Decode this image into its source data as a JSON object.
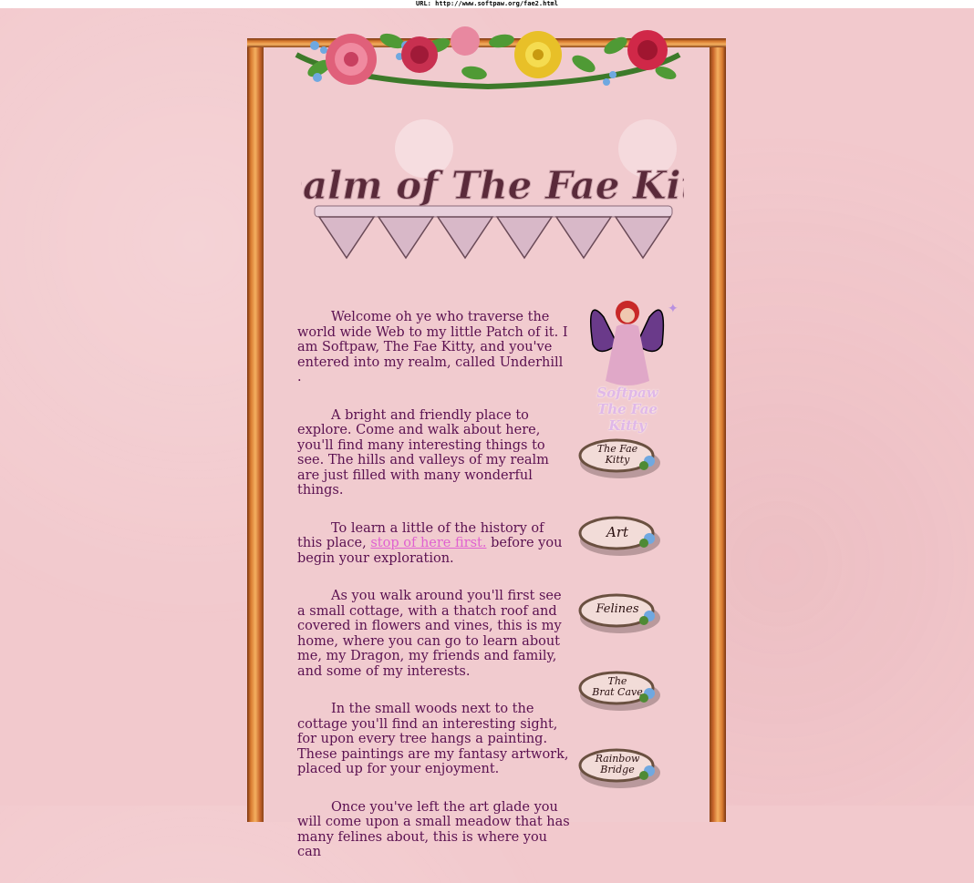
{
  "url_bar": {
    "text": "URL: http://www.softpaw.org/fae2.html"
  },
  "header": {
    "title_art_text": "Realm of The Fae Kitty"
  },
  "content": {
    "p1": "Welcome oh ye who traverse the world wide Web to my little Patch of it. I am Softpaw, The Fae Kitty, and you've entered into my realm, called Underhill .",
    "p2": "A bright and friendly place to explore. Come and walk about here, you'll find many interesting things to see. The hills and valleys of my realm are just filled with many wonderful things.",
    "p3_before": "To learn a little of the history of this place, ",
    "p3_link": "stop of here first.",
    "p3_after": " before you begin your exploration.",
    "p4": "As you walk around you'll first see a small cottage, with a thatch roof and covered in flowers and vines, this is my home, where you can go to learn about me, my Dragon, my friends and family, and some of my interests.",
    "p5": "In the small woods next to the cottage you'll find an interesting sight, for upon every tree hangs a painting. These paintings are my fantasy artwork, placed up for your enjoyment.",
    "p6": "Once you've left the art glade you will come upon a small  meadow that has many felines about, this is where you can"
  },
  "sidebar": {
    "fairy_caption_line1": "Softpaw",
    "fairy_caption_line2": "The Fae Kitty",
    "buttons": [
      {
        "label": "The Fae\nKitty"
      },
      {
        "label": "Art"
      },
      {
        "label": "Felines"
      },
      {
        "label": "The\nBrat Cave"
      },
      {
        "label": "Rainbow\nBridge"
      }
    ]
  },
  "colors": {
    "background": "#f2c9cd",
    "text": "#5a1050",
    "link": "#e060d0",
    "frame_wood": "#d87a30"
  }
}
